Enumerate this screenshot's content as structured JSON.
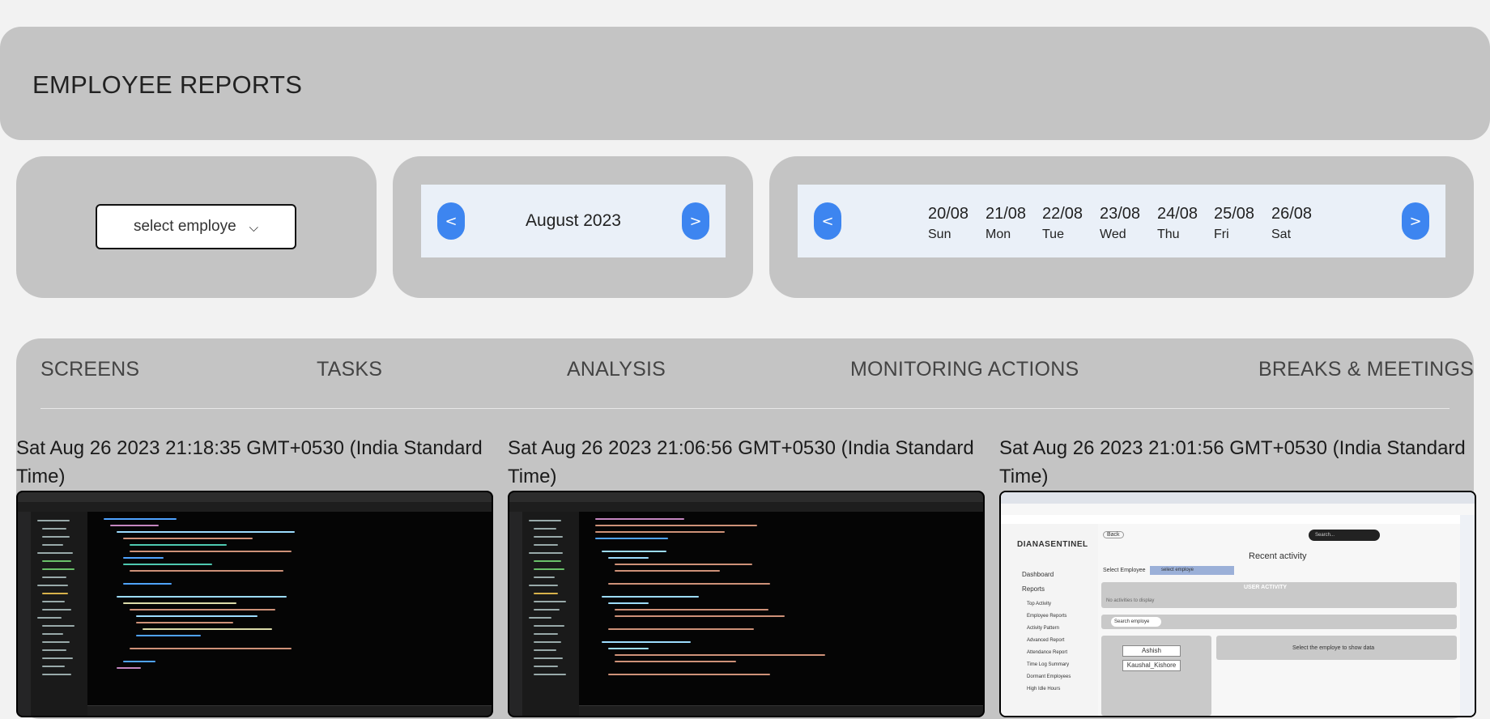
{
  "header": {
    "title": "EMPLOYEE REPORTS"
  },
  "employee_select": {
    "value": "select employe"
  },
  "month_nav": {
    "prev": "<",
    "label": "August 2023",
    "next": ">"
  },
  "week_nav": {
    "prev": "<",
    "next": ">",
    "days": [
      {
        "date": "20/08",
        "weekday": "Sun"
      },
      {
        "date": "21/08",
        "weekday": "Mon"
      },
      {
        "date": "22/08",
        "weekday": "Tue"
      },
      {
        "date": "23/08",
        "weekday": "Wed"
      },
      {
        "date": "24/08",
        "weekday": "Thu"
      },
      {
        "date": "25/08",
        "weekday": "Fri"
      },
      {
        "date": "26/08",
        "weekday": "Sat"
      }
    ]
  },
  "tabs": [
    {
      "label": "SCREENS"
    },
    {
      "label": "TASKS"
    },
    {
      "label": "ANALYSIS"
    },
    {
      "label": "MONITORING ACTIONS"
    },
    {
      "label": "BREAKS & MEETINGS"
    }
  ],
  "screenshots": [
    {
      "timestamp": "Sat Aug 26 2023 21:18:35 GMT+0530 (India Standard Time)"
    },
    {
      "timestamp": "Sat Aug 26 2023 21:06:56 GMT+0530 (India Standard Time)"
    },
    {
      "timestamp": "Sat Aug 26 2023 21:01:56 GMT+0530 (India Standard Time)"
    }
  ],
  "browser_shot": {
    "brand": "DIANASENTINEL",
    "back": "Back",
    "search": "Search...",
    "heading": "Recent activity",
    "select_label": "Select Employee",
    "select_value": "select employe",
    "user_activity": "USER ACTIVITY",
    "no_activities": "No activities to display",
    "search_employee": "Search employe",
    "show_data": "Select the employe to show data",
    "nav": [
      "Dashboard",
      "Reports",
      "Top Activity",
      "Employee Reports",
      "Activity Pattern",
      "Advanced Report",
      "Attendance Report",
      "Time Log Summary",
      "Dormant Employees",
      "High Idle Hours"
    ],
    "employees": [
      "Ashish",
      "Kaushal_Kishore"
    ]
  },
  "colors": {
    "accent": "#3d85f0",
    "card": "#c4c4c4",
    "panel": "#eaf0f8"
  }
}
